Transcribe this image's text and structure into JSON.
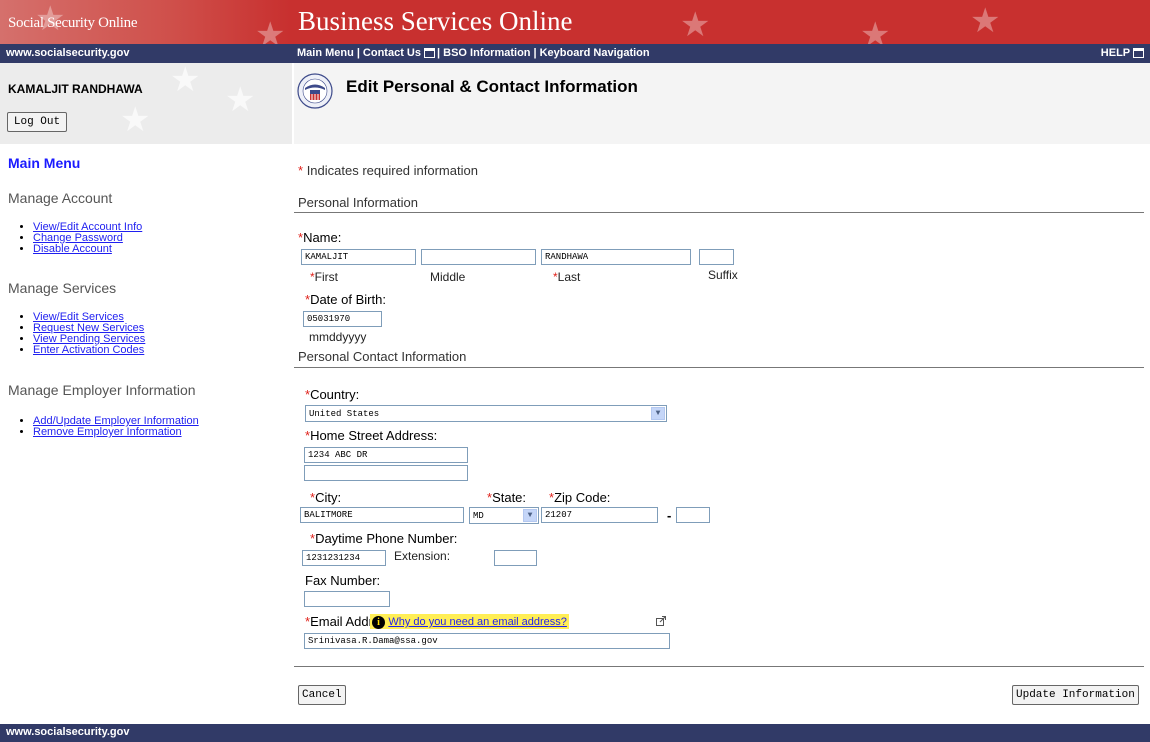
{
  "header": {
    "site_brand": "Social Security Online",
    "app_title": "Business Services Online",
    "site_url": "www.socialsecurity.gov",
    "nav": {
      "main_menu": "Main Menu",
      "contact_us": "Contact Us",
      "bso_information": "BSO Information",
      "keyboard_navigation": "Keyboard Navigation",
      "help": "HELP"
    },
    "user_name": "KAMALJIT RANDHAWA",
    "logout_label": "Log Out",
    "page_title": "Edit Personal & Contact Information"
  },
  "sidebar": {
    "main_menu": "Main Menu",
    "sections": [
      {
        "title": "Manage Account",
        "items": [
          "View/Edit Account Info",
          "Change Password",
          "Disable Account"
        ]
      },
      {
        "title": "Manage Services",
        "items": [
          "View/Edit Services",
          "Request New Services",
          "View Pending Services",
          "Enter Activation Codes"
        ]
      },
      {
        "title": "Manage Employer Information",
        "items": [
          "Add/Update Employer Information",
          "Remove Employer Information"
        ]
      }
    ]
  },
  "form": {
    "required_note": "Indicates required information",
    "required_mark": "*",
    "personal_section": "Personal Information",
    "name_label": "Name:",
    "first_value": "KAMALJIT",
    "middle_value": "",
    "last_value": "RANDHAWA",
    "suffix_value": "",
    "first_sub": "First",
    "middle_sub": "Middle",
    "last_sub": "Last",
    "suffix_sub": "Suffix",
    "dob_label": "Date of Birth:",
    "dob_value": "05031970",
    "dob_format": "mmddyyyy",
    "contact_section": "Personal Contact Information",
    "country_label": "Country:",
    "country_value": "United States",
    "street_label": "Home Street Address:",
    "street1_value": "1234 ABC DR",
    "street2_value": "",
    "city_label": "City:",
    "city_value": "BALITMORE",
    "state_label": "State:",
    "state_value": "MD",
    "zip_label": "Zip Code:",
    "zip_value": "21207",
    "zip_dash": "-",
    "zip4_value": "",
    "phone_label": "Daytime Phone Number:",
    "phone_value": "1231231234",
    "extension_label": "Extension:",
    "extension_value": "",
    "fax_label": "Fax Number:",
    "fax_value": "",
    "email_label": "Email Address:",
    "email_value": "Srinivasa.R.Dama@ssa.gov",
    "why_email_link": "Why do you need an email address?",
    "info_icon": "i"
  },
  "buttons": {
    "cancel": "Cancel",
    "update": "Update Information"
  },
  "footer": {
    "text": "www.socialsecurity.gov"
  },
  "colors": {
    "banner_red": "#c8302f",
    "nav_blue": "#313a67",
    "required_red": "#e0211a",
    "link_blue": "#1f1ff0"
  }
}
